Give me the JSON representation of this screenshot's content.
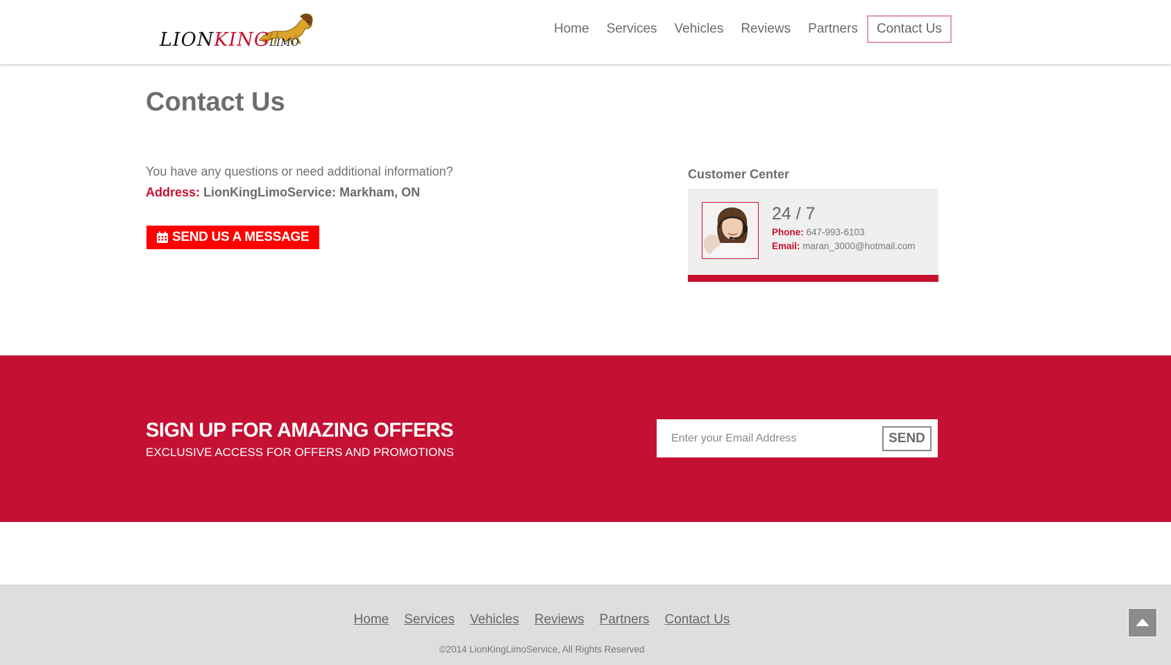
{
  "header": {
    "logo": {
      "part1": "LION",
      "part2": "KING",
      "part3": "LIMO"
    },
    "nav": [
      {
        "label": "Home"
      },
      {
        "label": "Services"
      },
      {
        "label": "Vehicles"
      },
      {
        "label": "Reviews"
      },
      {
        "label": "Partners"
      },
      {
        "label": "Contact Us",
        "active": true
      }
    ]
  },
  "main": {
    "title": "Contact Us",
    "intro": "You have any questions or need additional information?",
    "address_label": "Address:",
    "address_value": " LionKingLimoService: Markham, ON",
    "send_message_label": "SEND US A MESSAGE"
  },
  "customer_center": {
    "title": "Customer Center",
    "hours": "24 / 7",
    "phone_label": "Phone:",
    "phone_value": " 647-993-6103",
    "email_label": "Email:",
    "email_value": " maran_3000@hotmail.com"
  },
  "signup": {
    "heading": "SIGN UP FOR AMAZING OFFERS",
    "subheading": "EXCLUSIVE ACCESS FOR OFFERS AND PROMOTIONS",
    "email_placeholder": "Enter your Email Address",
    "email_value": "",
    "send_label": "SEND"
  },
  "footer": {
    "links": [
      {
        "label": "Home"
      },
      {
        "label": "Services"
      },
      {
        "label": "Vehicles"
      },
      {
        "label": "Reviews"
      },
      {
        "label": "Partners"
      },
      {
        "label": "Contact Us"
      }
    ],
    "copyright": "©2014 LionKingLimoService, All Rights Reserved"
  },
  "icons": {
    "calendar": "calendar-icon",
    "back_to_top": "chevron-up-icon",
    "lion": "lion-logo-icon",
    "avatar": "support-agent-avatar"
  },
  "colors": {
    "brand_red": "#c41133",
    "button_red": "#ff0000",
    "active_nav_border": "#e39aa8",
    "footer_bg": "#dedede"
  }
}
